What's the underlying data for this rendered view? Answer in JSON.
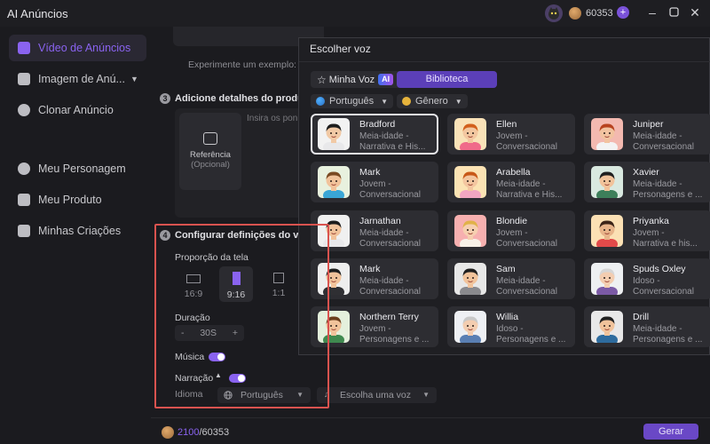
{
  "app": {
    "title": "AI Anúncios",
    "credits": "60353"
  },
  "sidebar": {
    "items": [
      {
        "label": "Vídeo de Anúncios",
        "active": true
      },
      {
        "label": "Imagem de Anú...",
        "has_dropdown": true
      },
      {
        "label": "Clonar Anúncio"
      },
      {
        "label": "Meu Personagem"
      },
      {
        "label": "Meu Produto"
      },
      {
        "label": "Minhas Criações"
      }
    ]
  },
  "main": {
    "example_text": "Experimente um exemplo:",
    "step3": {
      "number": "3",
      "title": "Adicione detalhes do produto"
    },
    "reference": {
      "label": "Referência",
      "sublabel": "(Opcional)"
    },
    "insira_placeholder": "Insira os pon",
    "step4": {
      "number": "4",
      "title": "Configurar definições do vídeo"
    },
    "aspect": {
      "label": "Proporção da tela",
      "options": [
        "16:9",
        "9:16",
        "1:1"
      ],
      "selected": "9:16"
    },
    "duration": {
      "label": "Duração",
      "minus": "-",
      "value": "30S",
      "plus": "+"
    },
    "music": {
      "label": "Música",
      "on": true
    },
    "narration": {
      "label": "Narração",
      "on": true
    },
    "language": {
      "label": "Idioma",
      "value": "Português",
      "voice_placeholder": "Escolha uma voz"
    }
  },
  "bottom": {
    "credits_used": "2100",
    "credits_total": "/60353",
    "generate_label": "Gerar"
  },
  "voice_modal": {
    "title": "Escolher voz",
    "tabs": {
      "mine": "Minha Voz",
      "ai_badge": "AI",
      "library": "Biblioteca"
    },
    "filters": {
      "language": "Português",
      "gender": "Gênero"
    },
    "voices": [
      {
        "name": "Bradford",
        "age": "Meia-idade -",
        "style": "Narrativa e His...",
        "selected": true,
        "skin": "#f1c9a5",
        "hair": "#1d1d1d",
        "shirt": "#e8e8ea",
        "bg": "#f2f2f2"
      },
      {
        "name": "Ellen",
        "age": "Jovem -",
        "style": "Conversacional",
        "skin": "#f3c7a0",
        "hair": "#d2601c",
        "shirt": "#f06a8a",
        "bg": "#f9e2b8"
      },
      {
        "name": "Juniper",
        "age": "Meia-idade -",
        "style": "Conversacional",
        "skin": "#f2c3a0",
        "hair": "#b8431f",
        "shirt": "#f3f3f3",
        "bg": "#f3b9b0"
      },
      {
        "name": "Mark",
        "age": "Jovem -",
        "style": "Conversacional",
        "skin": "#f1c39b",
        "hair": "#7a4a22",
        "shirt": "#3aa6d6",
        "bg": "#e8f1de"
      },
      {
        "name": "Arabella",
        "age": "Meia-idade -",
        "style": "Narrativa e His...",
        "skin": "#f3c6a0",
        "hair": "#c85818",
        "shirt": "#f2a6c1",
        "bg": "#fbe3b4"
      },
      {
        "name": "Xavier",
        "age": "Meia-idade -",
        "style": "Personagens e ...",
        "skin": "#f1c39b",
        "hair": "#1f1f1f",
        "shirt": "#3d7f5a",
        "bg": "#d9e9e0"
      },
      {
        "name": "Jarnathan",
        "age": "Meia-idade -",
        "style": "Conversacional",
        "skin": "#f1c39b",
        "hair": "#1c1c1c",
        "shirt": "#e8e8ea",
        "bg": "#f0f0f0"
      },
      {
        "name": "Blondie",
        "age": "Jovem -",
        "style": "Conversacional",
        "skin": "#f6cfb0",
        "hair": "#e1b24a",
        "shirt": "#f7f1e8",
        "bg": "#f7b0b0"
      },
      {
        "name": "Priyanka",
        "age": "Jovem -",
        "style": "Narrativa e his...",
        "skin": "#e8b48a",
        "hair": "#3c2418",
        "shirt": "#e24a4a",
        "bg": "#fbe0b4"
      },
      {
        "name": "Mark",
        "age": "Meia-idade -",
        "style": "Conversacional",
        "skin": "#f1c39b",
        "hair": "#1f1f1f",
        "shirt": "#2f2f33",
        "bg": "#eeeeee"
      },
      {
        "name": "Sam",
        "age": "Meia-idade -",
        "style": "Conversacional",
        "skin": "#f1c39b",
        "hair": "#1f1f1f",
        "shirt": "#8a8a8e",
        "bg": "#e7e7e7"
      },
      {
        "name": "Spuds Oxley",
        "age": "Idoso -",
        "style": "Conversacional",
        "skin": "#f3cdb0",
        "hair": "#d6d6d6",
        "shirt": "#7b5aa6",
        "bg": "#eef0f2"
      },
      {
        "name": "Northern Terry",
        "age": "Jovem -",
        "style": "Personagens e ...",
        "skin": "#f1c39b",
        "hair": "#6b3f1d",
        "shirt": "#3f8a4f",
        "bg": "#e4f0dc"
      },
      {
        "name": "Willia",
        "age": "Idoso -",
        "style": "Personagens e ...",
        "skin": "#f3cdb0",
        "hair": "#c9c9c9",
        "shirt": "#5a7fb3",
        "bg": "#eef0f4"
      },
      {
        "name": "Drill",
        "age": "Meia-idade -",
        "style": "Personagens e ...",
        "skin": "#f1c39b",
        "hair": "#1f1f1f",
        "shirt": "#2e6c9e",
        "bg": "#e8e8e8"
      }
    ]
  },
  "colors": {
    "accent": "#8a63f0",
    "annotation": "#d9534f"
  }
}
